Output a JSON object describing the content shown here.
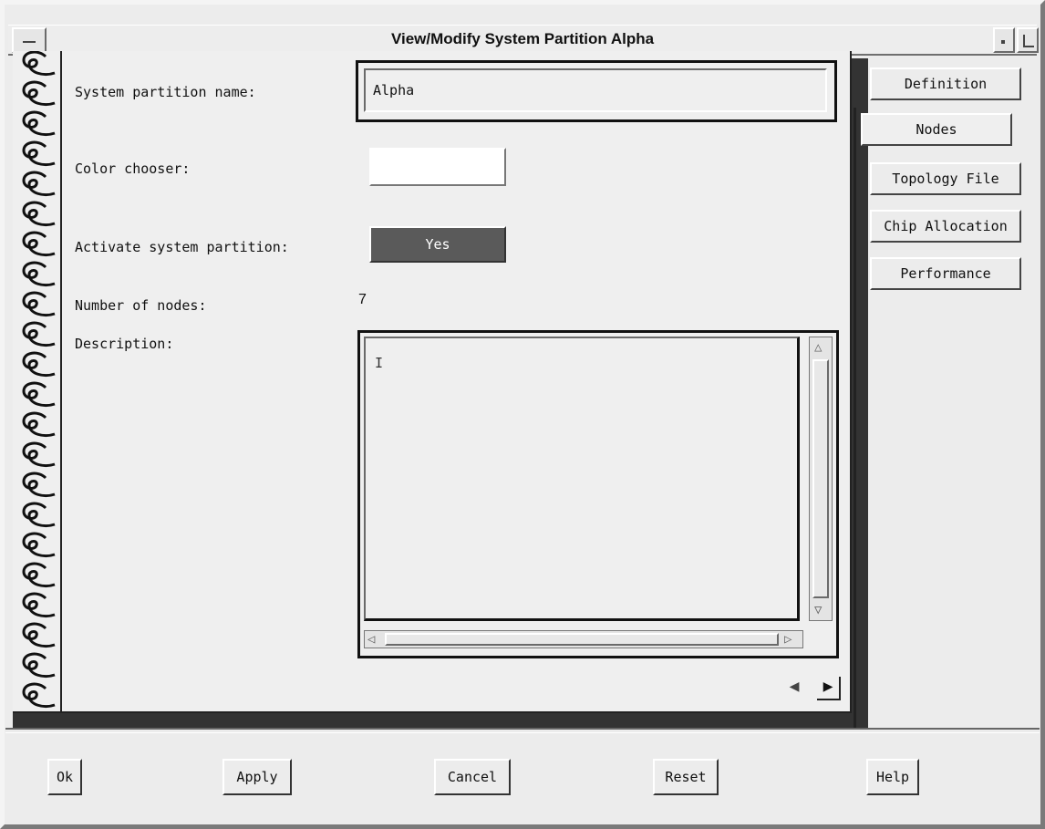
{
  "window": {
    "title": "View/Modify System Partition Alpha"
  },
  "form": {
    "name_label": "System partition name:",
    "name_value": "Alpha",
    "color_label": "Color chooser:",
    "activate_label": "Activate system partition:",
    "activate_value": "Yes",
    "nodes_label": "Number of nodes:",
    "nodes_value": "7",
    "description_label": "Description:",
    "description_value": ""
  },
  "tabs": [
    {
      "label": "Definition",
      "active": false
    },
    {
      "label": "Nodes",
      "active": true
    },
    {
      "label": "Topology File",
      "active": false
    },
    {
      "label": "Chip Allocation",
      "active": false
    },
    {
      "label": "Performance",
      "active": false
    }
  ],
  "buttons": {
    "ok": "Ok",
    "apply": "Apply",
    "cancel": "Cancel",
    "reset": "Reset",
    "help": "Help"
  },
  "colors": {
    "window_bg": "#ececec",
    "color_chooser_value": "#ffffff",
    "activate_button_bg": "#5a5a5a"
  },
  "icons": {
    "window_menu": "window-menu-icon",
    "minimize": "minimize-icon",
    "maximize": "maximize-icon",
    "binding": "spiral-binding-icon",
    "page_prev": "page-back-arrow-icon",
    "page_next": "page-forward-arrow-icon"
  }
}
